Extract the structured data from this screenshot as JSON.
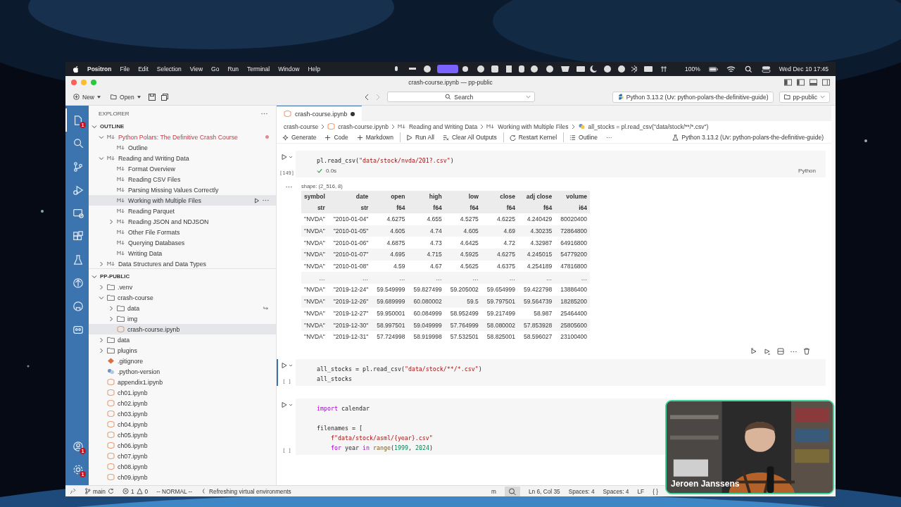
{
  "menu_bar": {
    "app": "Positron",
    "menus": [
      "File",
      "Edit",
      "Selection",
      "View",
      "Go",
      "Run",
      "Terminal",
      "Window",
      "Help"
    ],
    "battery": "100%",
    "clock": "Wed Dec 10  17:45"
  },
  "window": {
    "title": "crash-course.ipynb — pp-public"
  },
  "toolbar": {
    "new": "New",
    "open": "Open",
    "search_placeholder": "Search",
    "interpreter": "Python 3.13.2 (Uv: python-polars-the-definitive-guide)",
    "folder": "pp-public"
  },
  "activity_bar": {
    "top": [
      {
        "selected": true,
        "badge": "1"
      },
      {
        "selected": false
      },
      {
        "selected": false
      },
      {
        "selected": false
      },
      {
        "selected": false
      },
      {
        "selected": false
      },
      {
        "selected": false
      },
      {
        "selected": false
      },
      {
        "selected": false
      },
      {
        "selected": false
      }
    ],
    "bottom": [
      {
        "badge": "1"
      },
      {
        "badge": "1"
      }
    ]
  },
  "sidebar": {
    "title": "EXPLORER",
    "outline": {
      "title": "OUTLINE",
      "items": [
        {
          "label": "Python Polars: The Definitive Crash Course",
          "expanded": true,
          "selected": false,
          "modified": true,
          "children": [
            {
              "label": "Outline",
              "selected": false
            }
          ]
        },
        {
          "label": "Reading and Writing Data",
          "expanded": true,
          "selected": false,
          "modified": false,
          "children": [
            {
              "label": "Format Overview",
              "selected": false
            },
            {
              "label": "Reading CSV Files",
              "selected": false
            },
            {
              "label": "Parsing Missing Values Correctly",
              "selected": false
            },
            {
              "label": "Working with Multiple Files",
              "selected": true
            },
            {
              "label": "Reading Parquet",
              "selected": false
            },
            {
              "label": "Reading JSON and NDJSON",
              "selected": false,
              "expanded": false
            },
            {
              "label": "Other File Formats",
              "selected": false
            },
            {
              "label": "Querying Databases",
              "selected": false
            },
            {
              "label": "Writing Data",
              "selected": false
            }
          ]
        },
        {
          "label": "Data Structures and Data Types",
          "expanded": false,
          "selected": false,
          "modified": false
        }
      ]
    },
    "files": {
      "title": "PP-PUBLIC",
      "items": [
        {
          "label": ".venv",
          "kind": "folder",
          "expanded": false,
          "selected": false
        },
        {
          "label": "crash-course",
          "kind": "folder",
          "expanded": true,
          "selected": false,
          "children": [
            {
              "label": "data",
              "kind": "folder",
              "expanded": false,
              "selected": false,
              "symlink": true
            },
            {
              "label": "img",
              "kind": "folder",
              "expanded": false,
              "selected": false,
              "symlink": false
            },
            {
              "label": "crash-course.ipynb",
              "kind": "notebook",
              "selected": true,
              "symlink": false
            }
          ]
        },
        {
          "label": "data",
          "kind": "folder",
          "expanded": false,
          "selected": false
        },
        {
          "label": "plugins",
          "kind": "folder",
          "expanded": false,
          "selected": false
        },
        {
          "label": ".gitignore",
          "kind": "git",
          "selected": false
        },
        {
          "label": ".python-version",
          "kind": "python",
          "selected": false
        },
        {
          "label": "appendix1.ipynb",
          "kind": "notebook",
          "selected": false
        },
        {
          "label": "ch01.ipynb",
          "kind": "notebook",
          "selected": false
        },
        {
          "label": "ch02.ipynb",
          "kind": "notebook",
          "selected": false
        },
        {
          "label": "ch03.ipynb",
          "kind": "notebook",
          "selected": false
        },
        {
          "label": "ch04.ipynb",
          "kind": "notebook",
          "selected": false
        },
        {
          "label": "ch05.ipynb",
          "kind": "notebook",
          "selected": false
        },
        {
          "label": "ch06.ipynb",
          "kind": "notebook",
          "selected": false
        },
        {
          "label": "ch07.ipynb",
          "kind": "notebook",
          "selected": false
        },
        {
          "label": "ch08.ipynb",
          "kind": "notebook",
          "selected": false
        },
        {
          "label": "ch09.ipynb",
          "kind": "notebook",
          "selected": false
        }
      ]
    }
  },
  "editor": {
    "tab": {
      "label": "crash-course.ipynb",
      "modified": true,
      "selected": true
    },
    "breadcrumbs": [
      {
        "text": "crash-course",
        "kind": "folder"
      },
      {
        "text": "crash-course.ipynb",
        "kind": "notebook"
      },
      {
        "text": "Reading and Writing Data",
        "kind": "markdown"
      },
      {
        "text": "Working with Multiple Files",
        "kind": "markdown"
      },
      {
        "text": "all_stocks = pl.read_csv(\"data/stock/**/*.csv\")",
        "kind": "python"
      }
    ],
    "notebook_toolbar": [
      {
        "label": "Generate",
        "kind": "sparkle",
        "separator_before": false
      },
      {
        "label": "Code",
        "kind": "plus",
        "separator_before": false
      },
      {
        "label": "Markdown",
        "kind": "plus",
        "separator_before": false
      },
      {
        "label": "Run All",
        "kind": "play",
        "separator_before": true
      },
      {
        "label": "Clear All Outputs",
        "kind": "clear",
        "separator_before": false
      },
      {
        "label": "Restart Kernel",
        "kind": "restart",
        "separator_before": true
      },
      {
        "label": "Outline",
        "kind": "list",
        "separator_before": true
      },
      {
        "label": "···",
        "kind": "more",
        "separator_before": false
      }
    ],
    "kernel": "Python 3.13.2 (Uv: python-polars-the-definitive-guide)",
    "cells": [
      {
        "selected": false,
        "execution": "[149]",
        "duration": "0.0s",
        "language": "Python",
        "lines": [
          {
            "gap_before": false,
            "indented": false,
            "segments": [
              {
                "text": "pl.read_csv(",
                "kind": "plain"
              },
              {
                "text": "\"data/stock/nvda/201?.csv\"",
                "kind": "string"
              },
              {
                "text": ")",
                "kind": "plain"
              }
            ]
          }
        ],
        "output": {
          "shape": "shape: (2_516, 8)",
          "columns": [
            {
              "name": "symbol",
              "dtype": "str"
            },
            {
              "name": "date",
              "dtype": "str"
            },
            {
              "name": "open",
              "dtype": "f64"
            },
            {
              "name": "high",
              "dtype": "f64"
            },
            {
              "name": "low",
              "dtype": "f64"
            },
            {
              "name": "close",
              "dtype": "f64"
            },
            {
              "name": "adj close",
              "dtype": "f64"
            },
            {
              "name": "volume",
              "dtype": "i64"
            }
          ],
          "rows": [
            [
              "\"NVDA\"",
              "\"2010-01-04\"",
              "4.6275",
              "4.655",
              "4.5275",
              "4.6225",
              "4.240429",
              "80020400"
            ],
            [
              "\"NVDA\"",
              "\"2010-01-05\"",
              "4.605",
              "4.74",
              "4.605",
              "4.69",
              "4.30235",
              "72864800"
            ],
            [
              "\"NVDA\"",
              "\"2010-01-06\"",
              "4.6875",
              "4.73",
              "4.6425",
              "4.72",
              "4.32987",
              "64916800"
            ],
            [
              "\"NVDA\"",
              "\"2010-01-07\"",
              "4.695",
              "4.715",
              "4.5925",
              "4.6275",
              "4.245015",
              "54779200"
            ],
            [
              "\"NVDA\"",
              "\"2010-01-08\"",
              "4.59",
              "4.67",
              "4.5625",
              "4.6375",
              "4.254189",
              "47816800"
            ],
            [
              "…",
              "…",
              "…",
              "…",
              "…",
              "…",
              "…",
              "…"
            ],
            [
              "\"NVDA\"",
              "\"2019-12-24\"",
              "59.549999",
              "59.827499",
              "59.205002",
              "59.654999",
              "59.422798",
              "13886400"
            ],
            [
              "\"NVDA\"",
              "\"2019-12-26\"",
              "59.689999",
              "60.080002",
              "59.5",
              "59.797501",
              "59.564739",
              "18285200"
            ],
            [
              "\"NVDA\"",
              "\"2019-12-27\"",
              "59.950001",
              "60.084999",
              "58.952499",
              "59.217499",
              "58.987",
              "25464400"
            ],
            [
              "\"NVDA\"",
              "\"2019-12-30\"",
              "58.997501",
              "59.049999",
              "57.764999",
              "58.080002",
              "57.853928",
              "25805600"
            ],
            [
              "\"NVDA\"",
              "\"2019-12-31\"",
              "57.724998",
              "58.919998",
              "57.532501",
              "58.825001",
              "58.596027",
              "23100400"
            ]
          ]
        }
      },
      {
        "selected": true,
        "execution": "[ ]",
        "lines": [
          {
            "gap_before": false,
            "indented": false,
            "segments": [
              {
                "text": "all_stocks = pl.read_csv(",
                "kind": "plain"
              },
              {
                "text": "\"data/stock/**/*.csv\"",
                "kind": "string"
              },
              {
                "text": ")",
                "kind": "plain"
              }
            ]
          },
          {
            "gap_before": false,
            "indented": false,
            "segments": [
              {
                "text": "all_stocks",
                "kind": "plain"
              }
            ]
          }
        ]
      },
      {
        "selected": false,
        "execution": "[ ]",
        "lines": [
          {
            "gap_before": false,
            "indented": false,
            "segments": [
              {
                "text": "import",
                "kind": "keyword"
              },
              {
                "text": " calendar",
                "kind": "plain"
              }
            ]
          },
          {
            "gap_before": true,
            "indented": false,
            "segments": [
              {
                "text": "filenames = [",
                "kind": "plain"
              }
            ]
          },
          {
            "gap_before": false,
            "indented": true,
            "segments": [
              {
                "text": "f\"data/stock/asml/{year}.csv\"",
                "kind": "string"
              }
            ]
          },
          {
            "gap_before": false,
            "indented": true,
            "segments": [
              {
                "text": "for",
                "kind": "keyword"
              },
              {
                "text": " year ",
                "kind": "plain"
              },
              {
                "text": "in",
                "kind": "keyword"
              },
              {
                "text": " range",
                "kind": "builtin"
              },
              {
                "text": "(",
                "kind": "plain"
              },
              {
                "text": "1999",
                "kind": "number"
              },
              {
                "text": ", ",
                "kind": "plain"
              },
              {
                "text": "2024",
                "kind": "number"
              },
              {
                "text": ")",
                "kind": "plain"
              }
            ]
          }
        ]
      }
    ]
  },
  "status_bar": {
    "branch": "main",
    "errors": "1",
    "warnings": "0",
    "mode": "-- NORMAL --",
    "message": "Refreshing virtual environments",
    "right": [
      "m",
      "Ln 6, Col 35",
      "Spaces: 4",
      "Spaces: 4",
      "LF",
      "{ }"
    ]
  },
  "webcam": {
    "kind": "picture",
    "caption": "Jeroen Janssens"
  }
}
